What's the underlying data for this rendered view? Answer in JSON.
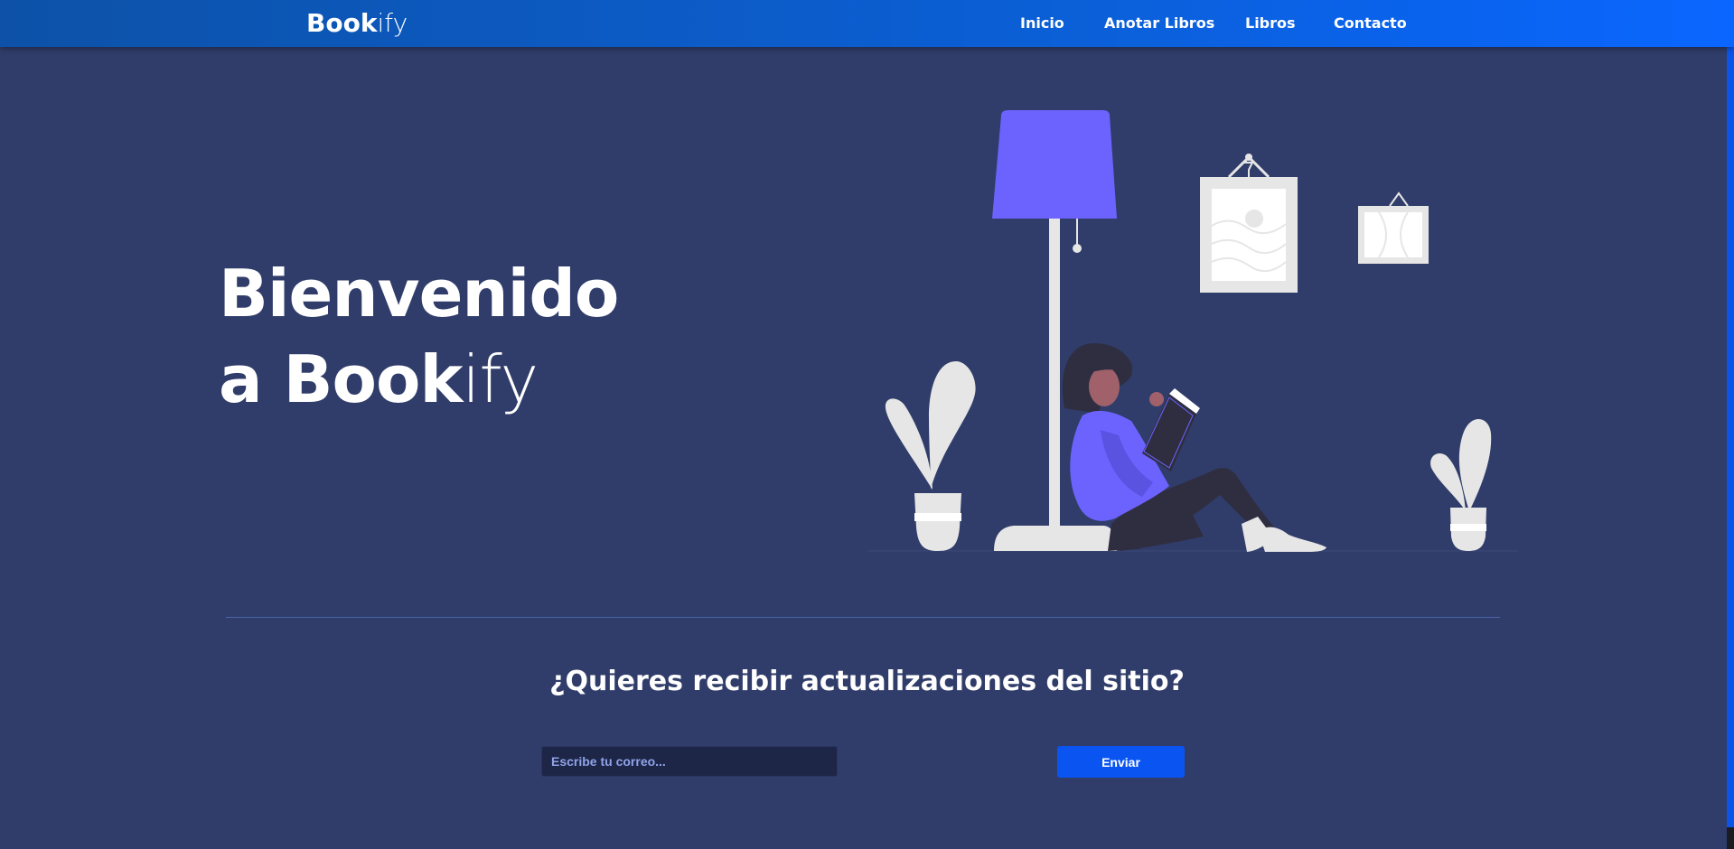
{
  "navbar": {
    "brand_bold": "Book",
    "brand_light": "ify",
    "links": [
      {
        "label": "Inicio"
      },
      {
        "label": "Anotar Libros"
      },
      {
        "label": "Libros"
      },
      {
        "label": "Contacto"
      }
    ]
  },
  "hero": {
    "line1": "Bienvenido",
    "line2_prefix": "a ",
    "line2_bold": "Book",
    "line2_light": "ify"
  },
  "newsletter": {
    "title": "¿Quieres recibir actualizaciones del sitio?",
    "email_placeholder": "Escribe tu correo...",
    "email_value": "",
    "submit_label": "Enviar"
  },
  "colors": {
    "background": "#303d6a",
    "navbar_start": "#0d52a8",
    "navbar_end": "#0a66ff",
    "accent_purple": "#6c63ff",
    "button_blue": "#0a55f2"
  }
}
